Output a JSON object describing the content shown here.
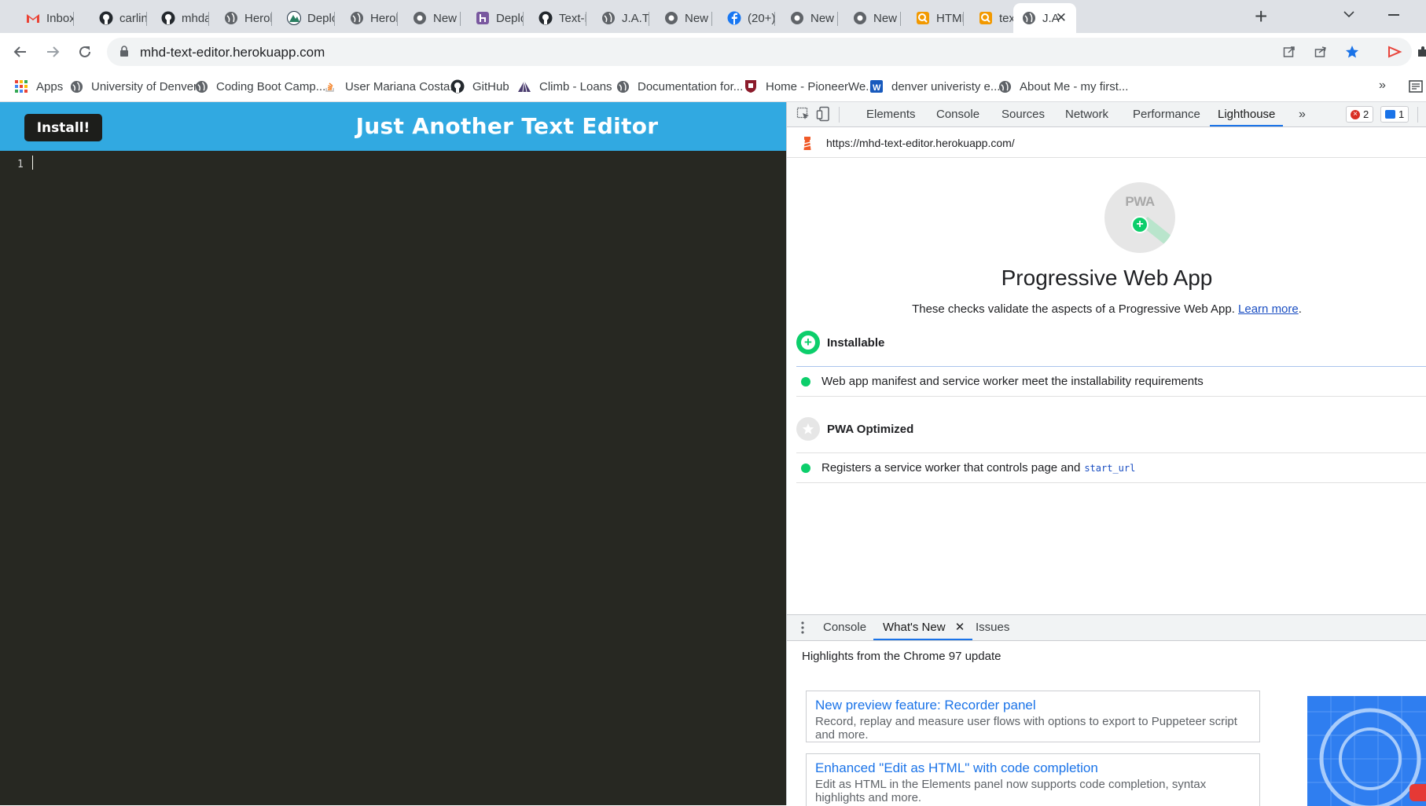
{
  "browser": {
    "tabs": [
      {
        "title": "Inbox",
        "icon": "gmail-icon"
      },
      {
        "title": "carlinc",
        "icon": "github-icon"
      },
      {
        "title": "mhdav",
        "icon": "github-icon"
      },
      {
        "title": "Heroku",
        "icon": "globe-icon"
      },
      {
        "title": "Deploy",
        "icon": "heroku-mountain-icon"
      },
      {
        "title": "Heroku",
        "icon": "globe-icon"
      },
      {
        "title": "New T",
        "icon": "chrome-icon"
      },
      {
        "title": "Deploy",
        "icon": "heroku-icon"
      },
      {
        "title": "Text-E",
        "icon": "github-icon"
      },
      {
        "title": "J.A.T.E",
        "icon": "globe-icon"
      },
      {
        "title": "New T",
        "icon": "chrome-icon"
      },
      {
        "title": "(20+)",
        "icon": "facebook-icon"
      },
      {
        "title": "New T",
        "icon": "chrome-icon"
      },
      {
        "title": "New T",
        "icon": "chrome-icon"
      },
      {
        "title": "HTML",
        "icon": "search-q-icon"
      },
      {
        "title": "text ed",
        "icon": "search-q-icon"
      },
      {
        "title": "J.A",
        "icon": "globe-icon",
        "active": true
      }
    ],
    "url": "mhd-text-editor.herokuapp.com",
    "bookmarks": [
      {
        "label": "Apps",
        "icon": "apps-grid-icon"
      },
      {
        "label": "University of Denver",
        "icon": "globe-icon"
      },
      {
        "label": "Coding Boot Camp...",
        "icon": "globe-icon"
      },
      {
        "label": "User Mariana Costa...",
        "icon": "stackoverflow-icon"
      },
      {
        "label": "GitHub",
        "icon": "github-icon"
      },
      {
        "label": "Climb - Loans",
        "icon": "climb-icon"
      },
      {
        "label": "Documentation for...",
        "icon": "globe-icon"
      },
      {
        "label": "Home - PioneerWe...",
        "icon": "pioneer-shield-icon"
      },
      {
        "label": "denver univeristy e...",
        "icon": "word-icon"
      },
      {
        "label": "About Me - my first...",
        "icon": "globe-icon"
      }
    ]
  },
  "app": {
    "install_label": "Install!",
    "title": "Just Another Text Editor",
    "line_number": "1"
  },
  "devtools": {
    "tabs": [
      "Elements",
      "Console",
      "Sources",
      "Network",
      "Performance",
      "Lighthouse"
    ],
    "active_tab": "Lighthouse",
    "errors_count": "2",
    "messages_count": "1",
    "report_url": "https://mhd-text-editor.herokuapp.com/",
    "gauge_label": "PWA",
    "category_title": "Progressive Web App",
    "category_desc": "These checks validate the aspects of a Progressive Web App.",
    "learn_more": "Learn more",
    "groups": [
      {
        "title": "Installable",
        "audits": [
          "Web app manifest and service worker meet the installability requirements"
        ]
      },
      {
        "title": "PWA Optimized",
        "audits": [
          "Registers a service worker that controls page and"
        ]
      }
    ],
    "audit_code": "start_url",
    "drawer": {
      "tabs": [
        "Console",
        "What's New",
        "Issues"
      ],
      "active_tab": "What's New",
      "highlights": "Highlights from the Chrome 97 update",
      "cards": [
        {
          "title": "New preview feature: Recorder panel",
          "desc": "Record, replay and measure user flows with options to export to Puppeteer script and more."
        },
        {
          "title": "Enhanced \"Edit as HTML\" with code completion",
          "desc": "Edit as HTML in the Elements panel now supports code completion, syntax highlights and more."
        }
      ]
    }
  },
  "colors": {
    "app_header": "#31a9e1",
    "editor_bg": "#272822",
    "pass_green": "#0cce6b",
    "devtools_accent": "#1a73e8"
  }
}
